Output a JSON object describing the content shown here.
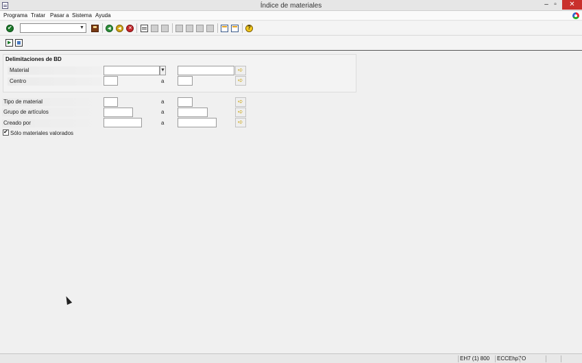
{
  "window": {
    "title": "Índice de materiales",
    "minimize_glyph": "–",
    "maximize_glyph": "▫",
    "close_glyph": "✕"
  },
  "menu": {
    "items": [
      "Programa",
      "Tratar",
      "Pasar a",
      "Sistema",
      "Ayuda"
    ]
  },
  "toolbar": {
    "command_field_value": "",
    "icons": [
      "enter-icon",
      "save-icon",
      "back-icon",
      "exit-icon",
      "cancel-icon",
      "print-icon",
      "find-icon",
      "find-next-icon",
      "first-page-icon",
      "previous-page-icon",
      "next-page-icon",
      "last-page-icon",
      "new-session-icon",
      "shortcut-icon",
      "help-icon"
    ]
  },
  "app_toolbar": {
    "icons": [
      "execute-icon",
      "get-variant-icon"
    ]
  },
  "selection": {
    "group_title": "Delimitaciones de BD",
    "to_label": "a",
    "rows": [
      {
        "label": "Material",
        "from": "",
        "to": ""
      },
      {
        "label": "Centro",
        "from": "",
        "to": ""
      },
      {
        "label": "Tipo de material",
        "from": "",
        "to": ""
      },
      {
        "label": "Grupo de artículos",
        "from": "",
        "to": ""
      },
      {
        "label": "Creado por",
        "from": "",
        "to": ""
      }
    ],
    "checkbox": {
      "label": "Sólo materiales valorados",
      "checked": true
    }
  },
  "statusbar": {
    "system": "EH7 (1) 800",
    "server": "ECCEhp7",
    "mode": "O"
  },
  "colors": {
    "accent_green": "#1c7a2a",
    "close_red": "#c9302c",
    "arrow_yellow": "#c9a000"
  }
}
